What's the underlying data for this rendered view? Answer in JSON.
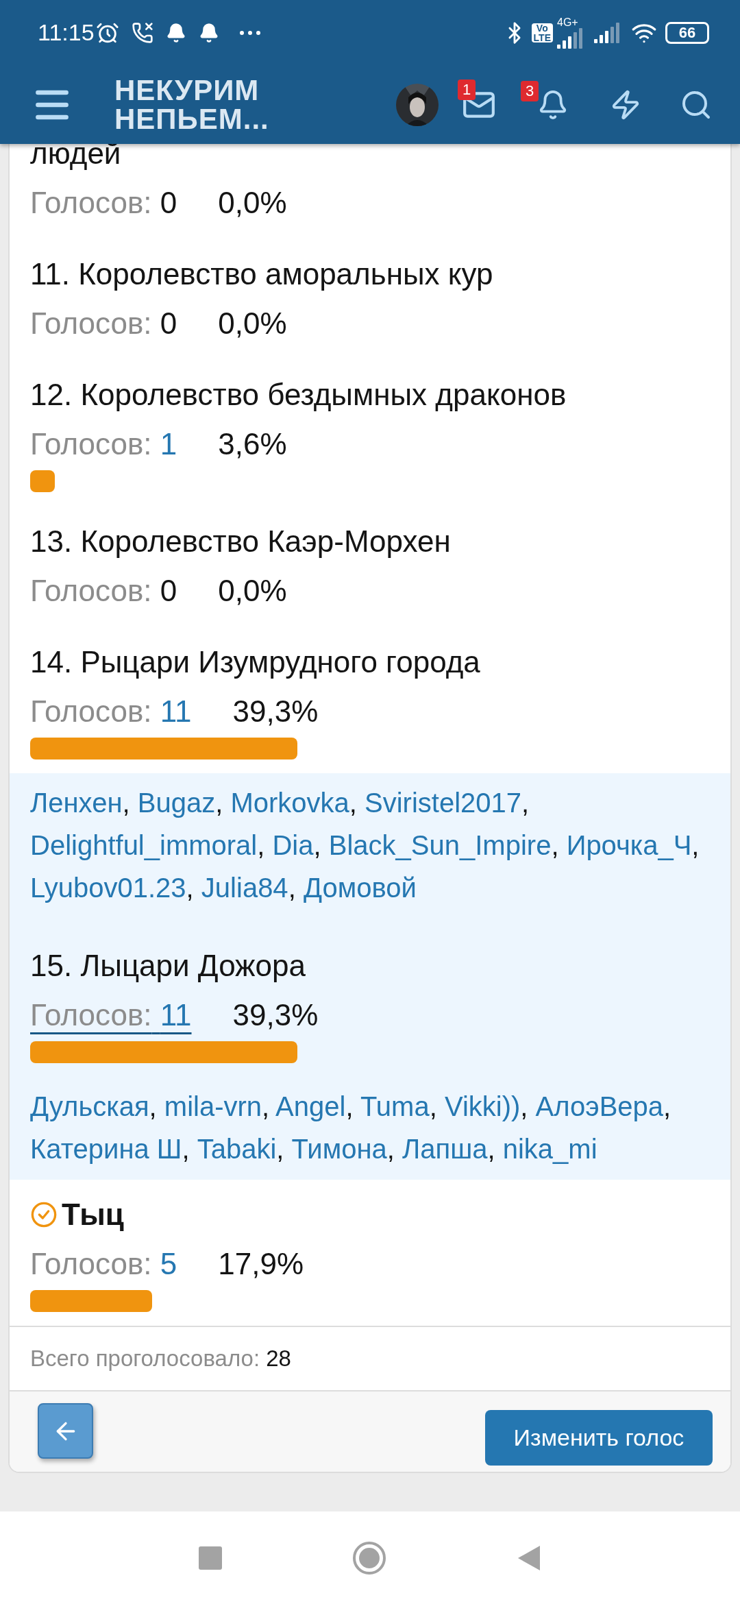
{
  "status_bar": {
    "time": "11:15",
    "volte": [
      "Vo",
      "LTE"
    ],
    "network": "4G+",
    "battery": "66"
  },
  "header": {
    "logo": [
      "НЕКУРИМ",
      "НЕПЬЕМ..."
    ],
    "inbox_badge": "1",
    "alerts_badge": "3"
  },
  "options": [
    {
      "title": "людей",
      "votes_label": "Голосов:",
      "votes": "0",
      "percent": "0,0%",
      "voted": false,
      "hovered": false
    },
    {
      "title": "11. Королевство аморальных кур",
      "votes_label": "Голосов:",
      "votes": "0",
      "percent": "0,0%",
      "voted": false,
      "hovered": false
    },
    {
      "title": "12. Королевство бездымных драконов",
      "votes_label": "Голосов:",
      "votes": "1",
      "percent": "3,6%",
      "voted": false,
      "hovered": false
    },
    {
      "title": "13. Королевство Каэр-Морхен",
      "votes_label": "Голосов:",
      "votes": "0",
      "percent": "0,0%",
      "voted": false,
      "hovered": false
    },
    {
      "title": "14. Рыцари Изумрудного города",
      "votes_label": "Голосов:",
      "votes": "11",
      "percent": "39,3%",
      "voted": false,
      "hovered": false,
      "voter_separator": ",",
      "voters": [
        "Ленхен",
        "Bugaz",
        "Morkovka",
        "Sviristel2017",
        "Delightful_immoral",
        "Dia",
        "Black_Sun_Impire",
        "Ирочка_Ч",
        "Lyubov01.23",
        "Julia84",
        "Домовой"
      ]
    },
    {
      "title": "15. Лыцари Дожора",
      "votes_label": "Голосов:",
      "votes": "11",
      "percent": "39,3%",
      "voted": false,
      "hovered": true,
      "voter_separator": ",",
      "voters": [
        "Дульская",
        "mila-vrn",
        "Angel",
        "Tuma",
        "Vikki))",
        "АлоэВера",
        "Катерина Ш",
        "Tabaki",
        "Тимона",
        "Лапша",
        "nika_mi"
      ]
    },
    {
      "title": "Тыц",
      "votes_label": "Голосов:",
      "votes": "5",
      "percent": "17,9%",
      "voted": true,
      "hovered": false
    }
  ],
  "footer": {
    "total_label": "Всего проголосовало:",
    "total": "28",
    "change_button": "Изменить голос"
  }
}
